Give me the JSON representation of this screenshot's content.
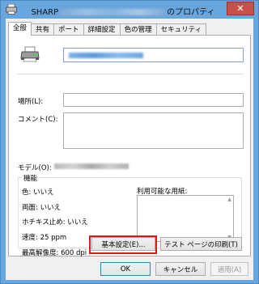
{
  "window": {
    "title_prefix": "SHARP",
    "title_suffix": "のプロパティ",
    "close_glyph": "✕"
  },
  "tabs": [
    {
      "label": "全般",
      "active": true
    },
    {
      "label": "共有",
      "active": false
    },
    {
      "label": "ポート",
      "active": false
    },
    {
      "label": "詳細設定",
      "active": false
    },
    {
      "label": "色の管理",
      "active": false
    },
    {
      "label": "セキュリティ",
      "active": false
    }
  ],
  "general": {
    "location_label": "場所(L):",
    "location_value": "",
    "comment_label": "コメント(C):",
    "comment_value": "",
    "model_label": "モデル(O):"
  },
  "features": {
    "group_title": "機能",
    "color": "色: いいえ",
    "duplex": "両面: いいえ",
    "staple": "ホチキス止め: いいえ",
    "speed": "速度: 25 ppm",
    "max_resolution": "最高解像度: 600 dpi",
    "paper_label": "利用可能な用紙:"
  },
  "buttons": {
    "preferences": "基本設定(E)...",
    "test_page": "テスト ページの印刷(T)",
    "ok": "OK",
    "cancel": "キャンセル",
    "apply": "適用(A)"
  },
  "colors": {
    "highlight": "#e0191b",
    "titlebar": "#6aa6de",
    "close_button": "#c7504a"
  }
}
